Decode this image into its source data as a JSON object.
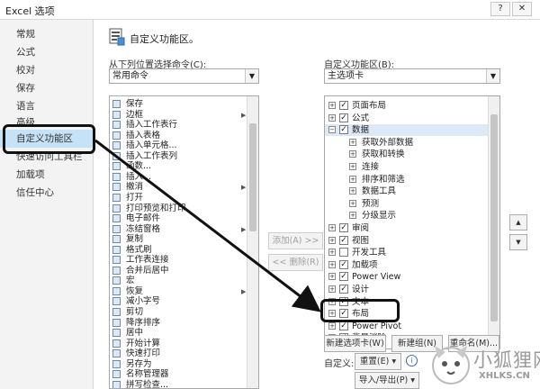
{
  "window": {
    "title": "Excel 选项"
  },
  "nav": [
    {
      "label": "常规",
      "selected": false
    },
    {
      "label": "公式",
      "selected": false
    },
    {
      "label": "校对",
      "selected": false
    },
    {
      "label": "保存",
      "selected": false
    },
    {
      "label": "语言",
      "selected": false
    },
    {
      "label": "高级",
      "selected": false
    },
    {
      "label": "自定义功能区",
      "selected": true
    },
    {
      "label": "快速访问工具栏",
      "selected": false
    },
    {
      "label": "加载项",
      "selected": false
    },
    {
      "label": "信任中心",
      "selected": false
    }
  ],
  "header": {
    "title": "自定义功能区。"
  },
  "left_panel": {
    "label": "从下列位置选择命令(C):",
    "combo_value": "常用命令",
    "commands": [
      {
        "label": "保存",
        "submenu": false
      },
      {
        "label": "边框",
        "submenu": true
      },
      {
        "label": "插入工作表行",
        "submenu": false
      },
      {
        "label": "插入表格",
        "submenu": false
      },
      {
        "label": "插入单元格...",
        "submenu": false
      },
      {
        "label": "插入工作表列",
        "submenu": false
      },
      {
        "label": "函数...",
        "submenu": false
      },
      {
        "label": "插入...",
        "submenu": false
      },
      {
        "label": "撤消",
        "submenu": true
      },
      {
        "label": "打开",
        "submenu": false
      },
      {
        "label": "打印预览和打印",
        "submenu": false
      },
      {
        "label": "电子邮件",
        "submenu": false
      },
      {
        "label": "冻结窗格",
        "submenu": true
      },
      {
        "label": "复制",
        "submenu": false
      },
      {
        "label": "格式刷",
        "submenu": false
      },
      {
        "label": "工作表连接",
        "submenu": false
      },
      {
        "label": "合并后居中",
        "submenu": false
      },
      {
        "label": "宏",
        "submenu": false
      },
      {
        "label": "恢复",
        "submenu": true
      },
      {
        "label": "减小字号",
        "submenu": false
      },
      {
        "label": "剪切",
        "submenu": false
      },
      {
        "label": "降序排序",
        "submenu": false
      },
      {
        "label": "居中",
        "submenu": false
      },
      {
        "label": "开始计算",
        "submenu": false
      },
      {
        "label": "快速打印",
        "submenu": false
      },
      {
        "label": "另存为",
        "submenu": false
      },
      {
        "label": "名称管理器",
        "submenu": false
      },
      {
        "label": "拼写检查...",
        "submenu": false
      }
    ]
  },
  "buttons": {
    "add": "添加(A) >>",
    "remove": "<< 删除(R)"
  },
  "right_panel": {
    "label": "自定义功能区(B):",
    "combo_value": "主选项卡",
    "tree": [
      {
        "label": "页面布局",
        "level": 0,
        "expander": "+",
        "checked": true
      },
      {
        "label": "公式",
        "level": 0,
        "expander": "+",
        "checked": true
      },
      {
        "label": "数据",
        "level": 0,
        "expander": "-",
        "checked": true,
        "highlight": true
      },
      {
        "label": "获取外部数据",
        "level": 1,
        "expander": "+",
        "checked": null
      },
      {
        "label": "获取和转换",
        "level": 1,
        "expander": "+",
        "checked": null
      },
      {
        "label": "连接",
        "level": 1,
        "expander": "+",
        "checked": null
      },
      {
        "label": "排序和筛选",
        "level": 1,
        "expander": "+",
        "checked": null
      },
      {
        "label": "数据工具",
        "level": 1,
        "expander": "+",
        "checked": null
      },
      {
        "label": "预测",
        "level": 1,
        "expander": "+",
        "checked": null
      },
      {
        "label": "分级显示",
        "level": 1,
        "expander": "+",
        "checked": null
      },
      {
        "label": "审阅",
        "level": 0,
        "expander": "+",
        "checked": true
      },
      {
        "label": "视图",
        "level": 0,
        "expander": "+",
        "checked": true
      },
      {
        "label": "开发工具",
        "level": 0,
        "expander": "+",
        "checked": false
      },
      {
        "label": "加载项",
        "level": 0,
        "expander": "+",
        "checked": true
      },
      {
        "label": "Power View",
        "level": 0,
        "expander": "+",
        "checked": true
      },
      {
        "label": "设计",
        "level": 0,
        "expander": "+",
        "checked": true
      },
      {
        "label": "文本",
        "level": 0,
        "expander": "+",
        "checked": true
      },
      {
        "label": "布局",
        "level": 0,
        "expander": "+",
        "checked": true
      },
      {
        "label": "Power Pivot",
        "level": 0,
        "expander": "+",
        "checked": true
      },
      {
        "label": "背景消除",
        "level": 0,
        "expander": "+",
        "checked": true
      }
    ],
    "new_tab": "新建选项卡(W)",
    "new_group": "新建组(N)",
    "rename": "重命名(M)...",
    "customize_label": "自定义:",
    "reset": "重置(E) ▾",
    "import_export": "导入/导出(P) ▾"
  },
  "watermark": {
    "text": "小狐狸网",
    "sub": "XHLKS.CN"
  },
  "colors": {
    "selected_nav": "#c5e2f6",
    "annotation": "#111111"
  }
}
